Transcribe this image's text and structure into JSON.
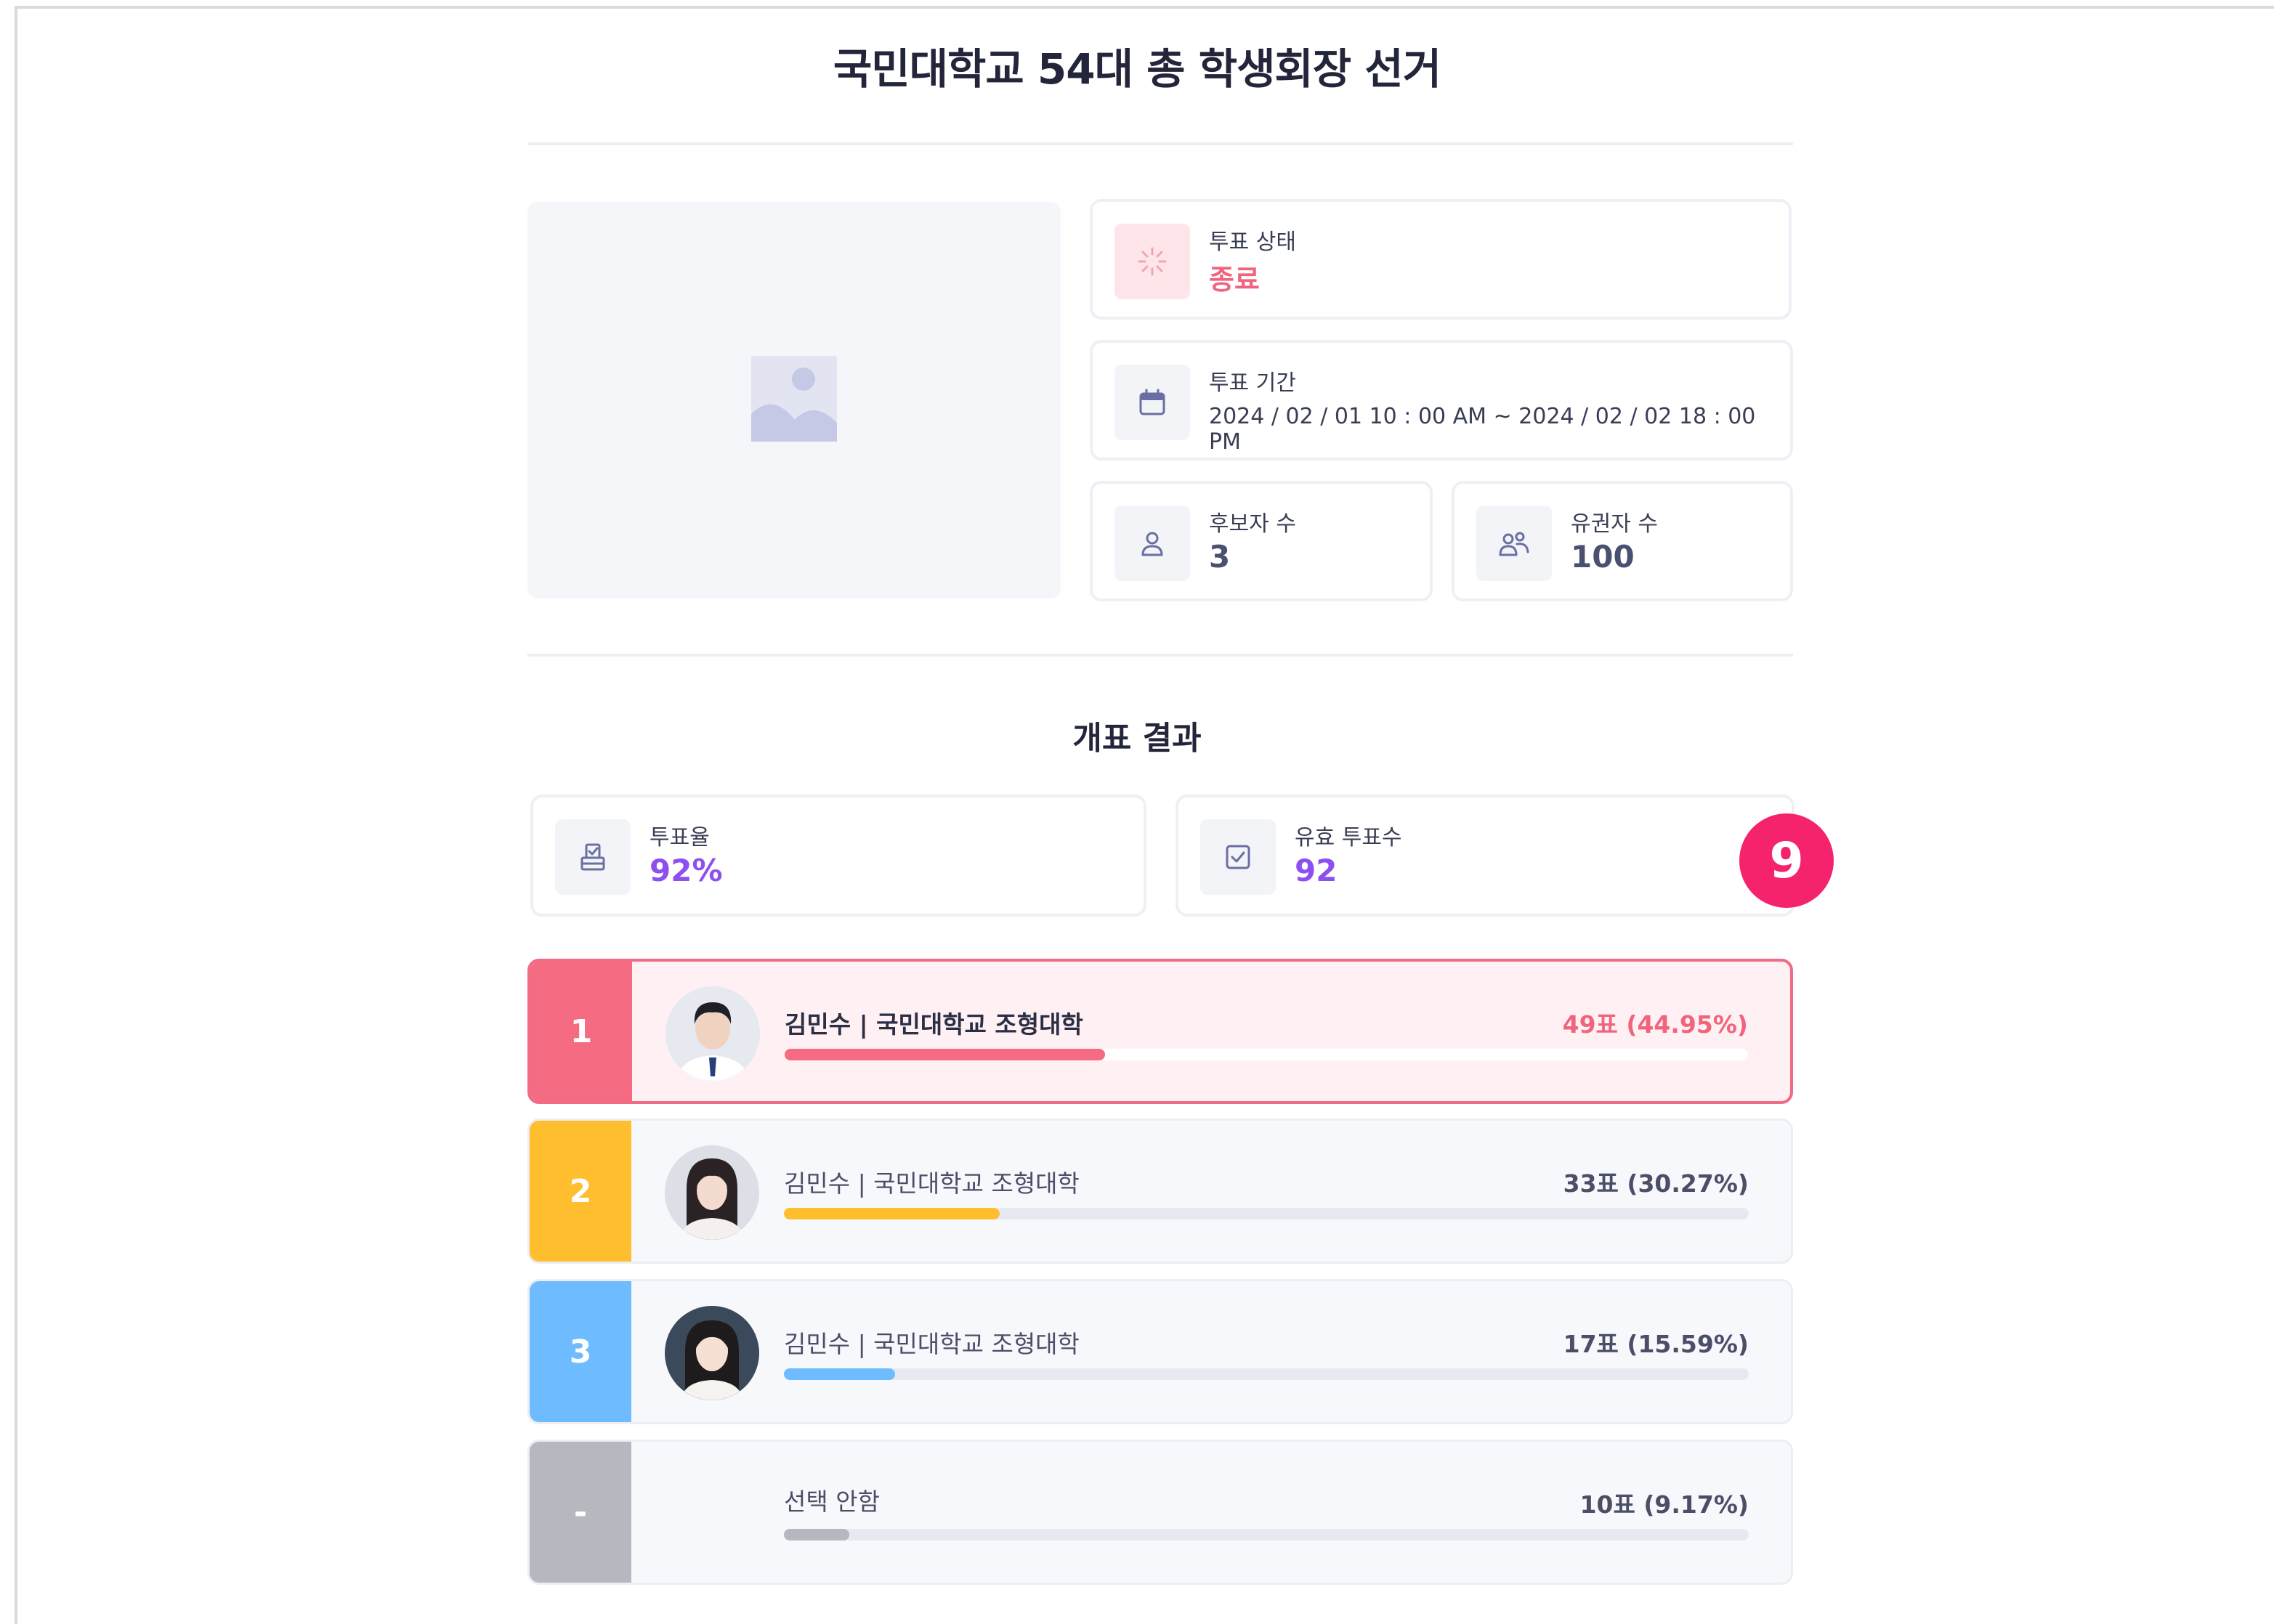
{
  "page": {
    "title": "국민대학교 54대 총 학생회장 선거"
  },
  "info": {
    "status": {
      "label": "투표 상태",
      "value": "종료"
    },
    "period": {
      "label": "투표 기간",
      "value": "2024 / 02 / 01  10 : 00 AM  ~  2024 / 02 / 02  18 : 00 PM"
    },
    "candidates": {
      "label": "후보자 수",
      "value": "3"
    },
    "voters": {
      "label": "유권자 수",
      "value": "100"
    }
  },
  "results": {
    "title": "개표 결과",
    "turnout": {
      "label": "투표율",
      "value": "92%"
    },
    "valid_votes": {
      "label": "유효 투표수",
      "value": "92"
    },
    "badge": "9",
    "rows": [
      {
        "rank": "1",
        "name": "김민수 | 국민대학교 조형대학",
        "votes": "49표 (44.95%)",
        "percent": 44.95,
        "color": "#f56b82"
      },
      {
        "rank": "2",
        "name": "김민수 | 국민대학교 조형대학",
        "votes": "33표 (30.27%)",
        "percent": 30.27,
        "color": "#ffbe2e"
      },
      {
        "rank": "3",
        "name": "김민수 | 국민대학교 조형대학",
        "votes": "17표 (15.59%)",
        "percent": 15.59,
        "color": "#6ebcff"
      },
      {
        "rank": "-",
        "name": "선택 안함",
        "votes": "10표 (9.17%)",
        "percent": 9.17,
        "color": "#b6b8c0"
      }
    ]
  },
  "icons": {
    "status": "loading-spinner-icon",
    "period": "calendar-icon",
    "candidates": "person-icon",
    "voters": "people-icon",
    "turnout": "ballot-box-icon",
    "valid_votes": "checkbox-icon",
    "image": "image-placeholder-icon"
  }
}
